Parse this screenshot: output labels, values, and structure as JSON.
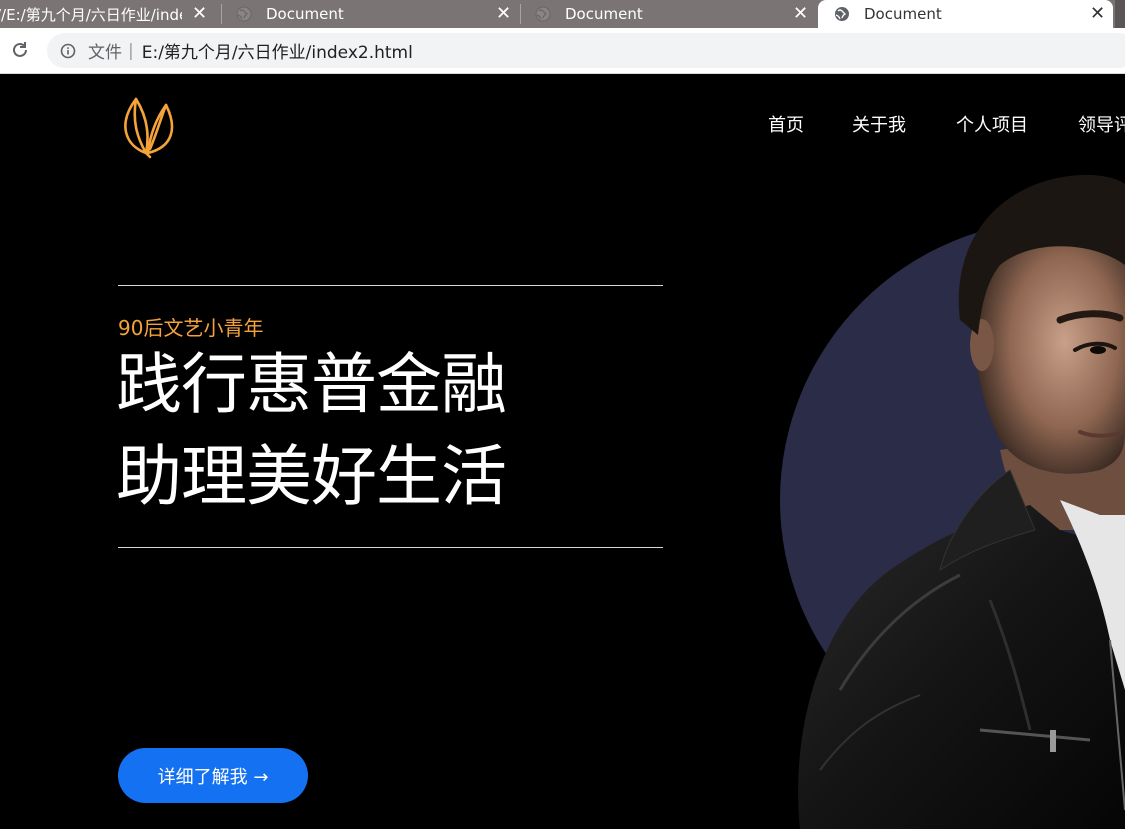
{
  "browser": {
    "tabs": [
      {
        "title": "//E:/第九个月/六日作业/index",
        "active": false
      },
      {
        "title": "Document",
        "active": false
      },
      {
        "title": "Document",
        "active": false
      },
      {
        "title": "Document",
        "active": true
      }
    ],
    "close_glyph": "✕",
    "address": {
      "file_label": "文件",
      "separator": "|",
      "url": "E:/第九个月/六日作业/index2.html"
    }
  },
  "page": {
    "nav": [
      "首页",
      "关于我",
      "个人项目",
      "领导评"
    ],
    "tagline": "90后文艺小青年",
    "headline_line1": "践行惠普金融",
    "headline_line2": "助理美好生活",
    "cta_label": "详细了解我 →"
  },
  "colors": {
    "background": "#000000",
    "accent_orange": "#f6a33a",
    "cta_blue": "#1472f2",
    "circle_navy": "#2a2c48",
    "tabbar_gray": "#7b7474"
  },
  "icons": [
    "globe-icon",
    "close-icon",
    "reload-icon",
    "info-icon",
    "leaf-logo-icon"
  ]
}
